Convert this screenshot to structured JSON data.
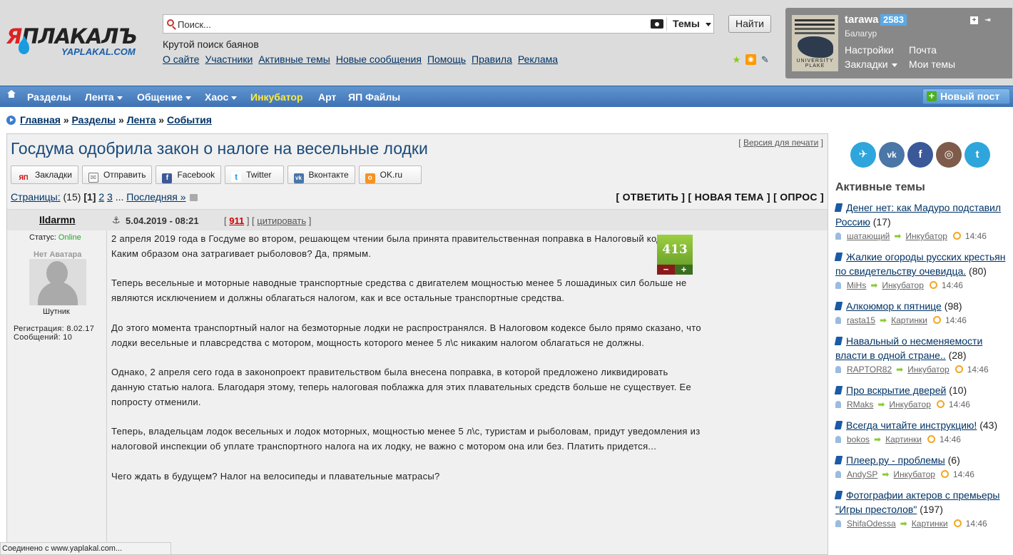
{
  "logo": {
    "main": "ЯПЛАКАЛЪ",
    "sub": "YAPLAKAL.COM"
  },
  "search": {
    "placeholder": "Поиск...",
    "scope": "Темы",
    "button": "Найти"
  },
  "tagline": "Крутой поиск баянов",
  "topnav": [
    "О сайте",
    "Участники",
    "Активные темы",
    "Новые сообщения",
    "Помощь",
    "Правила",
    "Реклама"
  ],
  "user": {
    "name": "tarawa",
    "karma": "2583",
    "rank": "Балагур",
    "settings": "Настройки",
    "mail": "Почта",
    "bookmarks": "Закладки",
    "my_topics": "Мои темы",
    "avatar_text": "UNIVERSITY PLAKE"
  },
  "nav": {
    "items": [
      "Разделы",
      "Лента",
      "Общение",
      "Хаос",
      "Инкубатор",
      "Арт",
      "ЯП Файлы"
    ],
    "new_post": "Новый пост"
  },
  "breadcrumb": {
    "items": [
      "Главная",
      "Разделы",
      "Лента",
      "События"
    ],
    "sep": "»"
  },
  "post": {
    "title": "Госдума одобрила закон о налоге на весельные лодки",
    "print_link": "Версия для печати",
    "share": [
      "Закладки",
      "Отправить",
      "Facebook",
      "Twitter",
      "Вконтакте",
      "OK.ru"
    ],
    "pages_label": "Страницы:",
    "pages_count": "(15)",
    "current_page": "[1]",
    "pages": [
      "2",
      "3"
    ],
    "ellipsis": "...",
    "last": "Последняя »",
    "actions": "[ ОТВЕТИТЬ ] [ НОВАЯ ТЕМА ] [ ОПРОС ]",
    "author": "Ildarmn",
    "anchor": "⚓",
    "date": "5.04.2019 - 08:21",
    "post_id": "911",
    "quote": "цитировать",
    "status_label": "Статус:",
    "status": "Online",
    "no_avatar": "Нет Аватара",
    "rank": "Шутник",
    "registered": "Регистрация: 8.02.17",
    "messages": "Сообщений: 10",
    "rating": "413",
    "paragraphs": [
      "2 апреля 2019 года в Госдуме во втором, решающем чтении была принята правительственная поправка в Налоговый кодекс. Каким образом она затрагивает рыболовов? Да, прямым.",
      "Теперь весельные и моторные наводные транспортные средства с двигателем мощностью менее 5 лошадиных сил больше не являются исключением и должны облагаться налогом, как и все остальные транспортные средства.",
      "До этого момента транспортный налог на безмоторные лодки не распространялся. В Налоговом кодексе было прямо сказано, что лодки весельные и плавсредства с мотором, мощность которого менее 5 л\\с никаким налогом облагаться не должны.",
      "Однако, 2 апреля сего года в законопроект правительством была внесена поправка, в которой предложено ликвидировать данную статью налога. Благодаря этому, теперь налоговая поблажка для этих плавательных средств больше не существует. Ее попросту отменили.",
      "Теперь, владельцам лодок весельных и лодок моторных, мощностью менее 5 л\\с, туристам и рыболовам, придут уведомления из налоговой инспекции об уплате транспортного налога на их лодку, не важно с мотором она или без. Платить придется...",
      "Чего ждать в будущем? Налог на велосипеды и плавательные матрасы?"
    ]
  },
  "sidebar": {
    "heading": "Активные темы",
    "topics": [
      {
        "title": "Денег нет: как Мадуро подставил Россию",
        "count": "(17)",
        "user": "шатающий",
        "section": "Инкубатор",
        "time": "14:46"
      },
      {
        "title": "Жалкие огороды русских крестьян по свидетельству очевидца.",
        "count": "(80)",
        "user": "MiHs",
        "section": "Инкубатор",
        "time": "14:46"
      },
      {
        "title": "Алкоюмор к пятнице",
        "count": "(98)",
        "user": "rasta15",
        "section": "Картинки",
        "time": "14:46"
      },
      {
        "title": "Навальный о несменяемости власти в одной стране..",
        "count": "(28)",
        "user": "RAPTOR82",
        "section": "Инкубатор",
        "time": "14:46"
      },
      {
        "title": "Про вскрытие дверей",
        "count": "(10)",
        "user": "RMaks",
        "section": "Инкубатор",
        "time": "14:46"
      },
      {
        "title": "Всегда читайте инструкцию!",
        "count": "(43)",
        "user": "bokos",
        "section": "Картинки",
        "time": "14:46"
      },
      {
        "title": "Плеер.ру - проблемы",
        "count": "(6)",
        "user": "AndySP",
        "section": "Инкубатор",
        "time": "14:46"
      },
      {
        "title": "Фотографии актеров с премьеры \"Игры престолов\"",
        "count": "(197)",
        "user": "ShifaOdessa",
        "section": "Картинки",
        "time": "14:46"
      }
    ]
  },
  "statusbar": "Соединено с www.yaplakal.com..."
}
